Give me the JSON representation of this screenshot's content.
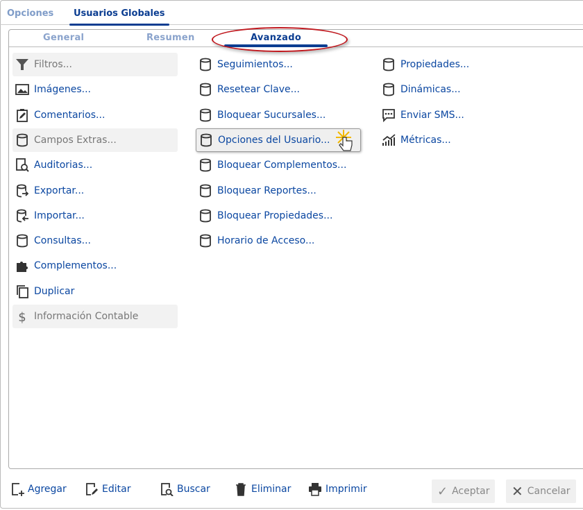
{
  "top_tabs": [
    {
      "label": "Opciones"
    },
    {
      "label": "Usuarios Globales",
      "active": true
    }
  ],
  "sub_tabs": [
    {
      "label": "General"
    },
    {
      "label": "Resumen"
    },
    {
      "label": "Avanzado",
      "active": true
    }
  ],
  "col1": [
    {
      "label": "Filtros...",
      "icon": "filter-icon",
      "disabled": true
    },
    {
      "label": "Imágenes...",
      "icon": "image-icon"
    },
    {
      "label": "Comentarios...",
      "icon": "clipboard-edit-icon"
    },
    {
      "label": "Campos Extras...",
      "icon": "database-icon",
      "disabled": true
    },
    {
      "label": "Auditorias...",
      "icon": "audit-search-icon"
    },
    {
      "label": "Exportar...",
      "icon": "database-export-icon"
    },
    {
      "label": "Importar...",
      "icon": "database-import-icon"
    },
    {
      "label": "Consultas...",
      "icon": "database-icon"
    },
    {
      "label": "Complementos...",
      "icon": "puzzle-icon"
    },
    {
      "label": "Duplicar",
      "icon": "copy-icon"
    },
    {
      "label": "Información Contable",
      "icon": "dollar-icon",
      "disabled": true
    }
  ],
  "col2": [
    {
      "label": "Seguimientos...",
      "icon": "database-icon"
    },
    {
      "label": "Resetear Clave...",
      "icon": "database-icon"
    },
    {
      "label": "Bloquear Sucursales...",
      "icon": "database-icon"
    },
    {
      "label": "Opciones del Usuario...",
      "icon": "database-icon",
      "highlighted": true
    },
    {
      "label": "Bloquear Complementos...",
      "icon": "database-icon"
    },
    {
      "label": "Bloquear Reportes...",
      "icon": "database-icon"
    },
    {
      "label": "Bloquear Propiedades...",
      "icon": "database-icon"
    },
    {
      "label": "Horario de Acceso...",
      "icon": "database-icon"
    }
  ],
  "col3": [
    {
      "label": "Propiedades...",
      "icon": "database-icon"
    },
    {
      "label": "Dinámicas...",
      "icon": "database-icon"
    },
    {
      "label": "Enviar SMS...",
      "icon": "sms-icon"
    },
    {
      "label": "Métricas...",
      "icon": "chart-icon"
    }
  ],
  "toolbar": [
    {
      "label": "Agregar",
      "icon": "add-icon"
    },
    {
      "label": "Editar",
      "icon": "edit-icon"
    },
    {
      "label": "Buscar",
      "icon": "search-icon"
    },
    {
      "label": "Eliminar",
      "icon": "trash-icon"
    },
    {
      "label": "Imprimir",
      "icon": "printer-icon"
    }
  ],
  "actions": {
    "accept": "Aceptar",
    "cancel": "Cancelar"
  },
  "colors": {
    "accent": "#0b3d91",
    "link": "#0b47a1",
    "annotation": "#c0181e"
  }
}
